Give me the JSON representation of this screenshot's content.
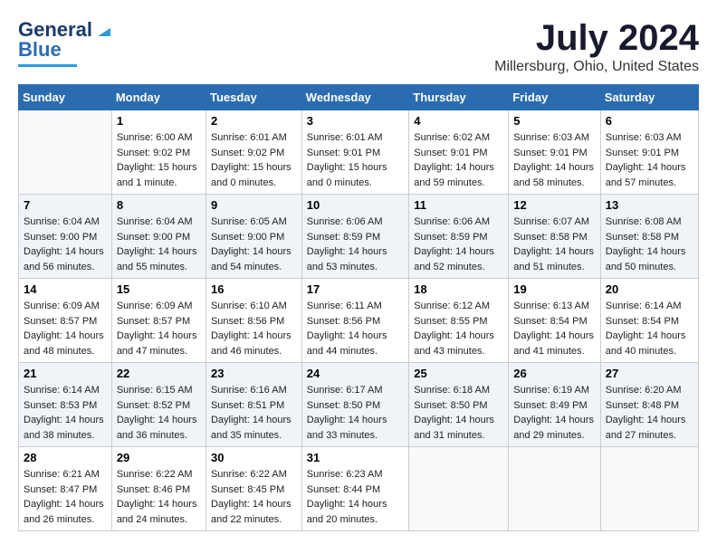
{
  "logo": {
    "line1": "General",
    "line2": "Blue"
  },
  "title": "July 2024",
  "subtitle": "Millersburg, Ohio, United States",
  "days_of_week": [
    "Sunday",
    "Monday",
    "Tuesday",
    "Wednesday",
    "Thursday",
    "Friday",
    "Saturday"
  ],
  "weeks": [
    [
      {
        "day": "",
        "sunrise": "",
        "sunset": "",
        "daylight": ""
      },
      {
        "day": "1",
        "sunrise": "Sunrise: 6:00 AM",
        "sunset": "Sunset: 9:02 PM",
        "daylight": "Daylight: 15 hours and 1 minute."
      },
      {
        "day": "2",
        "sunrise": "Sunrise: 6:01 AM",
        "sunset": "Sunset: 9:02 PM",
        "daylight": "Daylight: 15 hours and 0 minutes."
      },
      {
        "day": "3",
        "sunrise": "Sunrise: 6:01 AM",
        "sunset": "Sunset: 9:01 PM",
        "daylight": "Daylight: 15 hours and 0 minutes."
      },
      {
        "day": "4",
        "sunrise": "Sunrise: 6:02 AM",
        "sunset": "Sunset: 9:01 PM",
        "daylight": "Daylight: 14 hours and 59 minutes."
      },
      {
        "day": "5",
        "sunrise": "Sunrise: 6:03 AM",
        "sunset": "Sunset: 9:01 PM",
        "daylight": "Daylight: 14 hours and 58 minutes."
      },
      {
        "day": "6",
        "sunrise": "Sunrise: 6:03 AM",
        "sunset": "Sunset: 9:01 PM",
        "daylight": "Daylight: 14 hours and 57 minutes."
      }
    ],
    [
      {
        "day": "7",
        "sunrise": "Sunrise: 6:04 AM",
        "sunset": "Sunset: 9:00 PM",
        "daylight": "Daylight: 14 hours and 56 minutes."
      },
      {
        "day": "8",
        "sunrise": "Sunrise: 6:04 AM",
        "sunset": "Sunset: 9:00 PM",
        "daylight": "Daylight: 14 hours and 55 minutes."
      },
      {
        "day": "9",
        "sunrise": "Sunrise: 6:05 AM",
        "sunset": "Sunset: 9:00 PM",
        "daylight": "Daylight: 14 hours and 54 minutes."
      },
      {
        "day": "10",
        "sunrise": "Sunrise: 6:06 AM",
        "sunset": "Sunset: 8:59 PM",
        "daylight": "Daylight: 14 hours and 53 minutes."
      },
      {
        "day": "11",
        "sunrise": "Sunrise: 6:06 AM",
        "sunset": "Sunset: 8:59 PM",
        "daylight": "Daylight: 14 hours and 52 minutes."
      },
      {
        "day": "12",
        "sunrise": "Sunrise: 6:07 AM",
        "sunset": "Sunset: 8:58 PM",
        "daylight": "Daylight: 14 hours and 51 minutes."
      },
      {
        "day": "13",
        "sunrise": "Sunrise: 6:08 AM",
        "sunset": "Sunset: 8:58 PM",
        "daylight": "Daylight: 14 hours and 50 minutes."
      }
    ],
    [
      {
        "day": "14",
        "sunrise": "Sunrise: 6:09 AM",
        "sunset": "Sunset: 8:57 PM",
        "daylight": "Daylight: 14 hours and 48 minutes."
      },
      {
        "day": "15",
        "sunrise": "Sunrise: 6:09 AM",
        "sunset": "Sunset: 8:57 PM",
        "daylight": "Daylight: 14 hours and 47 minutes."
      },
      {
        "day": "16",
        "sunrise": "Sunrise: 6:10 AM",
        "sunset": "Sunset: 8:56 PM",
        "daylight": "Daylight: 14 hours and 46 minutes."
      },
      {
        "day": "17",
        "sunrise": "Sunrise: 6:11 AM",
        "sunset": "Sunset: 8:56 PM",
        "daylight": "Daylight: 14 hours and 44 minutes."
      },
      {
        "day": "18",
        "sunrise": "Sunrise: 6:12 AM",
        "sunset": "Sunset: 8:55 PM",
        "daylight": "Daylight: 14 hours and 43 minutes."
      },
      {
        "day": "19",
        "sunrise": "Sunrise: 6:13 AM",
        "sunset": "Sunset: 8:54 PM",
        "daylight": "Daylight: 14 hours and 41 minutes."
      },
      {
        "day": "20",
        "sunrise": "Sunrise: 6:14 AM",
        "sunset": "Sunset: 8:54 PM",
        "daylight": "Daylight: 14 hours and 40 minutes."
      }
    ],
    [
      {
        "day": "21",
        "sunrise": "Sunrise: 6:14 AM",
        "sunset": "Sunset: 8:53 PM",
        "daylight": "Daylight: 14 hours and 38 minutes."
      },
      {
        "day": "22",
        "sunrise": "Sunrise: 6:15 AM",
        "sunset": "Sunset: 8:52 PM",
        "daylight": "Daylight: 14 hours and 36 minutes."
      },
      {
        "day": "23",
        "sunrise": "Sunrise: 6:16 AM",
        "sunset": "Sunset: 8:51 PM",
        "daylight": "Daylight: 14 hours and 35 minutes."
      },
      {
        "day": "24",
        "sunrise": "Sunrise: 6:17 AM",
        "sunset": "Sunset: 8:50 PM",
        "daylight": "Daylight: 14 hours and 33 minutes."
      },
      {
        "day": "25",
        "sunrise": "Sunrise: 6:18 AM",
        "sunset": "Sunset: 8:50 PM",
        "daylight": "Daylight: 14 hours and 31 minutes."
      },
      {
        "day": "26",
        "sunrise": "Sunrise: 6:19 AM",
        "sunset": "Sunset: 8:49 PM",
        "daylight": "Daylight: 14 hours and 29 minutes."
      },
      {
        "day": "27",
        "sunrise": "Sunrise: 6:20 AM",
        "sunset": "Sunset: 8:48 PM",
        "daylight": "Daylight: 14 hours and 27 minutes."
      }
    ],
    [
      {
        "day": "28",
        "sunrise": "Sunrise: 6:21 AM",
        "sunset": "Sunset: 8:47 PM",
        "daylight": "Daylight: 14 hours and 26 minutes."
      },
      {
        "day": "29",
        "sunrise": "Sunrise: 6:22 AM",
        "sunset": "Sunset: 8:46 PM",
        "daylight": "Daylight: 14 hours and 24 minutes."
      },
      {
        "day": "30",
        "sunrise": "Sunrise: 6:22 AM",
        "sunset": "Sunset: 8:45 PM",
        "daylight": "Daylight: 14 hours and 22 minutes."
      },
      {
        "day": "31",
        "sunrise": "Sunrise: 6:23 AM",
        "sunset": "Sunset: 8:44 PM",
        "daylight": "Daylight: 14 hours and 20 minutes."
      },
      {
        "day": "",
        "sunrise": "",
        "sunset": "",
        "daylight": ""
      },
      {
        "day": "",
        "sunrise": "",
        "sunset": "",
        "daylight": ""
      },
      {
        "day": "",
        "sunrise": "",
        "sunset": "",
        "daylight": ""
      }
    ]
  ]
}
